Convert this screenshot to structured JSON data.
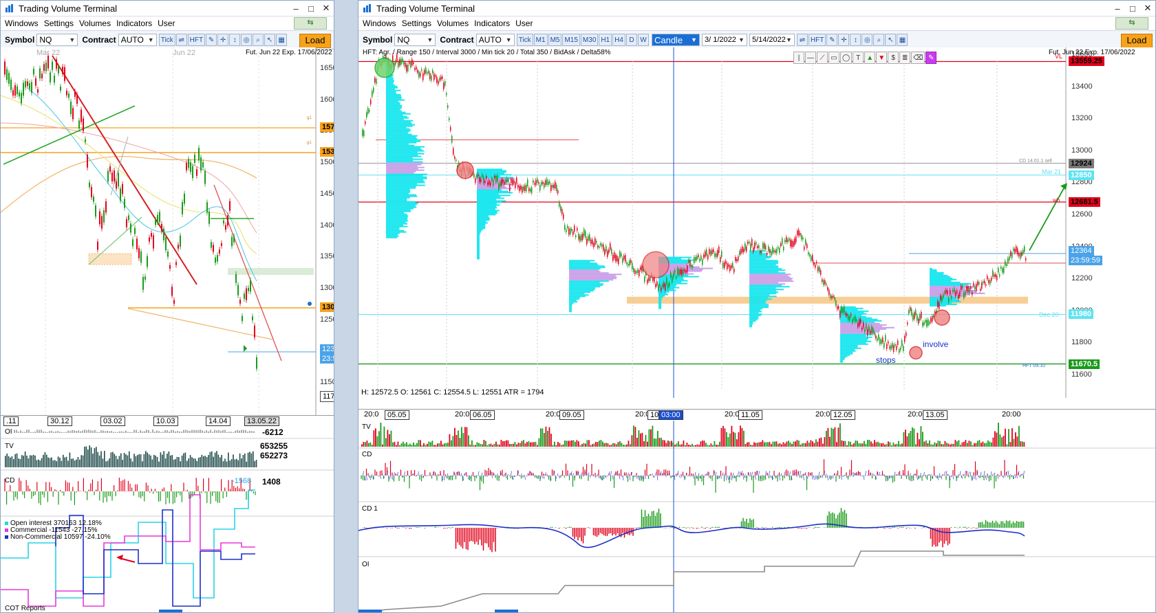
{
  "left_window": {
    "title": "Trading Volume Terminal",
    "menu": [
      "Windows",
      "Settings",
      "Volumes",
      "Indicators",
      "User"
    ],
    "toolbar": {
      "symbol_label": "Symbol",
      "symbol_value": "NQ",
      "contract_label": "Contract",
      "contract_value": "AUTO",
      "tick_btn": "Tick",
      "hft_btn": "HFT",
      "load_btn": "Load"
    },
    "chart": {
      "info": "Fut. Jun 22 Exp. 17/06/2022",
      "month_labels": [
        "Mar 22",
        "Jun 22"
      ],
      "price_ticks": [
        "16500",
        "16000",
        "15500",
        "15000",
        "14500",
        "14000",
        "13500",
        "13000",
        "12500",
        "12000",
        "11500"
      ],
      "level_tags": [
        "15707",
        "15346.75",
        "13041.25",
        "11724"
      ],
      "last_price": "12364",
      "countdown": "23:59:59",
      "date_ticks": [
        ".11",
        "30.12",
        "03.02",
        "10.03",
        "14.04",
        "13.05.22"
      ]
    },
    "panels": {
      "oi_label": "OI",
      "oi_value": "-6212",
      "tv_label": "TV",
      "tv_value1": "653255",
      "tv_value2": "652273",
      "cd_label": "CD",
      "cd_value": "1408",
      "cd_inline": "-1568",
      "cot_title": "COT Reports",
      "cot_legend": [
        {
          "name": "Open interest",
          "value": "370163",
          "pct": "12.18%",
          "color": "#27d3e8"
        },
        {
          "name": "Commercial",
          "value": "-11543",
          "pct": "-27.15%",
          "color": "#e63ad6"
        },
        {
          "name": "Non-Commercial",
          "value": "10597",
          "pct": "-24.10%",
          "color": "#1b2fc8"
        }
      ]
    }
  },
  "right_window": {
    "title": "Trading Volume Terminal",
    "menu": [
      "Windows",
      "Settings",
      "Volumes",
      "Indicators",
      "User"
    ],
    "toolbar": {
      "symbol_label": "Symbol",
      "symbol_value": "NQ",
      "contract_label": "Contract",
      "contract_value": "AUTO",
      "timeframes": [
        "Tick",
        "M1",
        "M5",
        "M15",
        "M30",
        "H1",
        "H4",
        "D",
        "W"
      ],
      "chart_type": "Candle",
      "date_from": "3/ 1/2022",
      "date_to": "5/14/2022",
      "hft_btn": "HFT",
      "load_btn": "Load"
    },
    "chart": {
      "header": "HFT: Agr. / Range 150 / Interval 3000 / Min tick 20 / Total 350 / BidAsk / Delta58%",
      "info": "Fut. Jun 22 Exp. 17/06/2022",
      "ohlc": "H: 12572.5  O: 12561  C: 12554.5  L: 12551  ATR = 1794",
      "price_ticks": [
        "13600",
        "13400",
        "13200",
        "13000",
        "12800",
        "12600",
        "12400",
        "12200",
        "12000",
        "11800",
        "11600"
      ],
      "level_tags": [
        {
          "text": "13559.25",
          "bg": "#e0001b",
          "fg": "#000"
        },
        {
          "text": "12924",
          "bg": "#7a7a7a",
          "fg": "#000"
        },
        {
          "text": "12850",
          "bg": "#5fe3f2",
          "fg": "#fff"
        },
        {
          "text": "12681.5",
          "bg": "#e0001b",
          "fg": "#000"
        },
        {
          "text": "11980",
          "bg": "#5fe3f2",
          "fg": "#fff"
        },
        {
          "text": "11670.5",
          "bg": "#1a9a1a",
          "fg": "#fff"
        }
      ],
      "last_price": "12364",
      "countdown": "23:59:59",
      "small_labels": [
        "VL",
        "CD 14.01.1 sell",
        "Mar 21",
        "wh",
        "Dec 20",
        "HFT 09.10"
      ],
      "annotations": [
        "stops",
        "involve"
      ],
      "time_ticks": [
        "20:0",
        "05.05",
        "20:0",
        "06.05",
        "20:00",
        "09.05",
        "20:0",
        "10",
        "03:00",
        "20:0",
        "11.05",
        "20:0",
        "12.05",
        "20:0",
        "13.05",
        "20:00"
      ]
    },
    "panels": [
      "TV",
      "CD",
      "CD 1",
      "OI"
    ]
  }
}
